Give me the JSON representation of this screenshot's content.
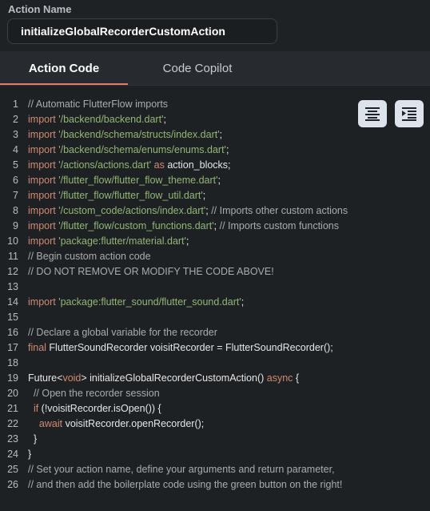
{
  "action_name": {
    "label": "Action Name",
    "value": "initializeGlobalRecorderCustomAction"
  },
  "tabs": [
    {
      "label": "Action Code",
      "active": true
    },
    {
      "label": "Code Copilot",
      "active": false
    }
  ],
  "editor": {
    "buttons": [
      {
        "icon": "align-center-icon"
      },
      {
        "icon": "indent-icon"
      }
    ],
    "lines": [
      {
        "n": "1",
        "tokens": [
          {
            "t": "// Automatic FlutterFlow imports",
            "c": "comment"
          }
        ]
      },
      {
        "n": "2",
        "tokens": [
          {
            "t": "import ",
            "c": "kw"
          },
          {
            "t": "'/backend/backend.dart'",
            "c": "str"
          },
          {
            "t": ";",
            "c": "plain"
          }
        ]
      },
      {
        "n": "3",
        "tokens": [
          {
            "t": "import ",
            "c": "kw"
          },
          {
            "t": "'/backend/schema/structs/index.dart'",
            "c": "str"
          },
          {
            "t": ";",
            "c": "plain"
          }
        ]
      },
      {
        "n": "4",
        "tokens": [
          {
            "t": "import ",
            "c": "kw"
          },
          {
            "t": "'/backend/schema/enums/enums.dart'",
            "c": "str"
          },
          {
            "t": ";",
            "c": "plain"
          }
        ]
      },
      {
        "n": "5",
        "tokens": [
          {
            "t": "import ",
            "c": "kw"
          },
          {
            "t": "'/actions/actions.dart'",
            "c": "str"
          },
          {
            "t": " as ",
            "c": "kw"
          },
          {
            "t": "action_blocks;",
            "c": "plain"
          }
        ]
      },
      {
        "n": "6",
        "tokens": [
          {
            "t": "import ",
            "c": "kw"
          },
          {
            "t": "'/flutter_flow/flutter_flow_theme.dart'",
            "c": "str"
          },
          {
            "t": ";",
            "c": "plain"
          }
        ]
      },
      {
        "n": "7",
        "tokens": [
          {
            "t": "import ",
            "c": "kw"
          },
          {
            "t": "'/flutter_flow/flutter_flow_util.dart'",
            "c": "str"
          },
          {
            "t": ";",
            "c": "plain"
          }
        ]
      },
      {
        "n": "8",
        "tokens": [
          {
            "t": "import ",
            "c": "kw"
          },
          {
            "t": "'/custom_code/actions/index.dart'",
            "c": "str"
          },
          {
            "t": "; ",
            "c": "plain"
          },
          {
            "t": "// Imports other custom actions",
            "c": "comment"
          }
        ]
      },
      {
        "n": "9",
        "tokens": [
          {
            "t": "import ",
            "c": "kw"
          },
          {
            "t": "'/flutter_flow/custom_functions.dart'",
            "c": "str"
          },
          {
            "t": "; ",
            "c": "plain"
          },
          {
            "t": "// Imports custom functions",
            "c": "comment"
          }
        ]
      },
      {
        "n": "10",
        "tokens": [
          {
            "t": "import ",
            "c": "kw"
          },
          {
            "t": "'package:flutter/material.dart'",
            "c": "str"
          },
          {
            "t": ";",
            "c": "plain"
          }
        ]
      },
      {
        "n": "11",
        "tokens": [
          {
            "t": "// Begin custom action code",
            "c": "comment"
          }
        ]
      },
      {
        "n": "12",
        "tokens": [
          {
            "t": "// DO NOT REMOVE OR MODIFY THE CODE ABOVE!",
            "c": "comment"
          }
        ]
      },
      {
        "n": "13",
        "tokens": []
      },
      {
        "n": "14",
        "tokens": [
          {
            "t": "import ",
            "c": "kw"
          },
          {
            "t": "'package:flutter_sound/flutter_sound.dart'",
            "c": "str"
          },
          {
            "t": ";",
            "c": "plain"
          }
        ]
      },
      {
        "n": "15",
        "tokens": []
      },
      {
        "n": "16",
        "tokens": [
          {
            "t": "// Declare a global variable for the recorder",
            "c": "comment"
          }
        ]
      },
      {
        "n": "17",
        "tokens": [
          {
            "t": "final ",
            "c": "kw"
          },
          {
            "t": "FlutterSoundRecorder voisitRecorder = FlutterSoundRecorder();",
            "c": "plain"
          }
        ]
      },
      {
        "n": "18",
        "tokens": []
      },
      {
        "n": "19",
        "tokens": [
          {
            "t": "Future<",
            "c": "plain"
          },
          {
            "t": "void",
            "c": "kw"
          },
          {
            "t": "> initializeGlobalRecorderCustomAction() ",
            "c": "plain"
          },
          {
            "t": "async",
            "c": "kw"
          },
          {
            "t": " {",
            "c": "plain"
          }
        ]
      },
      {
        "n": "20",
        "tokens": [
          {
            "t": "  // Open the recorder session",
            "c": "comment"
          }
        ]
      },
      {
        "n": "21",
        "tokens": [
          {
            "t": "  ",
            "c": "plain"
          },
          {
            "t": "if",
            "c": "kw"
          },
          {
            "t": " (!voisitRecorder.isOpen()) {",
            "c": "plain"
          }
        ]
      },
      {
        "n": "22",
        "tokens": [
          {
            "t": "    ",
            "c": "plain"
          },
          {
            "t": "await",
            "c": "kw"
          },
          {
            "t": " voisitRecorder.openRecorder();",
            "c": "plain"
          }
        ]
      },
      {
        "n": "23",
        "tokens": [
          {
            "t": "  }",
            "c": "plain"
          }
        ]
      },
      {
        "n": "24",
        "tokens": [
          {
            "t": "}",
            "c": "plain"
          }
        ]
      },
      {
        "n": "25",
        "tokens": [
          {
            "t": "// Set your action name, define your arguments and return parameter,",
            "c": "comment"
          }
        ]
      },
      {
        "n": "26",
        "tokens": [
          {
            "t": "// and then add the boilerplate code using the green button on the right!",
            "c": "comment"
          }
        ]
      }
    ]
  }
}
